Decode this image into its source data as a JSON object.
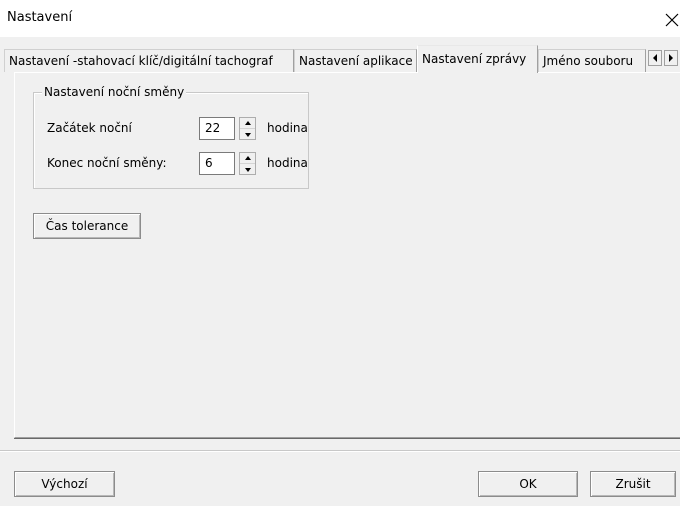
{
  "window": {
    "title": "Nastavení"
  },
  "tabs": [
    {
      "label": "Nastavení -stahovací klíč/digitální tachograf",
      "active": false
    },
    {
      "label": "Nastavení aplikace",
      "active": false
    },
    {
      "label": "Nastavení zprávy",
      "active": true
    },
    {
      "label": "Jméno souboru",
      "active": false
    }
  ],
  "icons": {
    "close": "close-icon",
    "scroll_left": "arrow-left-icon",
    "scroll_right": "arrow-right-icon",
    "spin_up": "spin-up-icon",
    "spin_down": "spin-down-icon"
  },
  "night_shift": {
    "legend": "Nastavení noční směny",
    "start": {
      "label": "Začátek noční",
      "value": "22",
      "unit": "hodina"
    },
    "end": {
      "label": "Konec noční směny:",
      "value": "6",
      "unit": "hodina"
    }
  },
  "tolerance_button": "Čas tolerance",
  "footer": {
    "default_button": "Výchozí",
    "ok_button": "OK",
    "cancel_button": "Zrušit"
  }
}
